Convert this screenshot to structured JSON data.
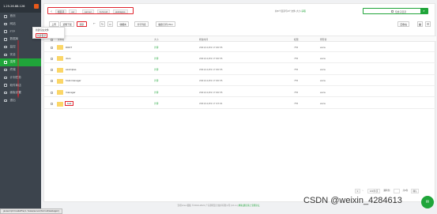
{
  "sidebar": {
    "ip": "1.25.26.88.126",
    "items": [
      {
        "label": "首页"
      },
      {
        "label": "网站"
      },
      {
        "label": "FTP"
      },
      {
        "label": "数据库"
      },
      {
        "label": "监控"
      },
      {
        "label": "安全"
      },
      {
        "label": "文件"
      },
      {
        "label": "终端"
      },
      {
        "label": "计划任务"
      },
      {
        "label": "软件商店"
      },
      {
        "label": "面板设置"
      },
      {
        "label": "退出"
      }
    ],
    "active_index": 6
  },
  "path": {
    "crumbs": [
      "根目录",
      "usr",
      "server",
      "tomcat",
      "webapps"
    ]
  },
  "disk_info": {
    "prefix": "共8个目录与0个文件,大小:",
    "link": "获取"
  },
  "search": {
    "label": "包含子目录",
    "button_icon": "search-icon"
  },
  "toolbar": {
    "upload": "上传",
    "remote_download": "远程下载",
    "new": "新建",
    "terminal": "终端",
    "favorites": "收藏夹",
    "share_list": "分享列表",
    "disk_space": "磁盘空间(/3G)",
    "recycle_bin": "回收站"
  },
  "new_menu": {
    "items": [
      "新建空白文件",
      "新建目录"
    ]
  },
  "table": {
    "headers": [
      "文件名",
      "大小",
      "修改时间",
      "权限",
      "所有者"
    ],
    "rows": [
      {
        "name": "ROOT",
        "size": "计算",
        "time": "2021/11/09 17:06:55",
        "perm": "755",
        "owner": "www"
      },
      {
        "name": "docs",
        "size": "计算",
        "time": "2021/11/09 17:06:55",
        "perm": "755",
        "owner": "www"
      },
      {
        "name": "examples",
        "size": "计算",
        "time": "2021/11/09 17:06:55",
        "perm": "755",
        "owner": "www"
      },
      {
        "name": "host-manager",
        "size": "计算",
        "time": "2021/11/09 17:06:55",
        "perm": "755",
        "owner": "www"
      },
      {
        "name": "manager",
        "size": "计算",
        "time": "2021/11/09 17:06:55",
        "perm": "755",
        "owner": "www"
      },
      {
        "name": "test",
        "size": "计算",
        "time": "2021/11/09 17:23:01",
        "perm": "755",
        "owner": "www"
      }
    ]
  },
  "pager": {
    "page": "1",
    "per_page": "100条/页",
    "goto": "跳转到",
    "total": "共6条",
    "confirm": "确认"
  },
  "footer": {
    "text": "宝塔Linux面板 ©2014-2021 广东堡塔安全技术有限公司 (bt.cn)",
    "link": "求助|建议请上宝塔论坛"
  },
  "statusbar": {
    "text": "javascript:CreateFile(1,'/www/server/tomcat/webapps')"
  },
  "watermark": "CSDN @weixin_4284613",
  "colors": {
    "accent": "#20a53a",
    "highlight": "#e0232c",
    "sidebar_bg": "#3c444d"
  }
}
